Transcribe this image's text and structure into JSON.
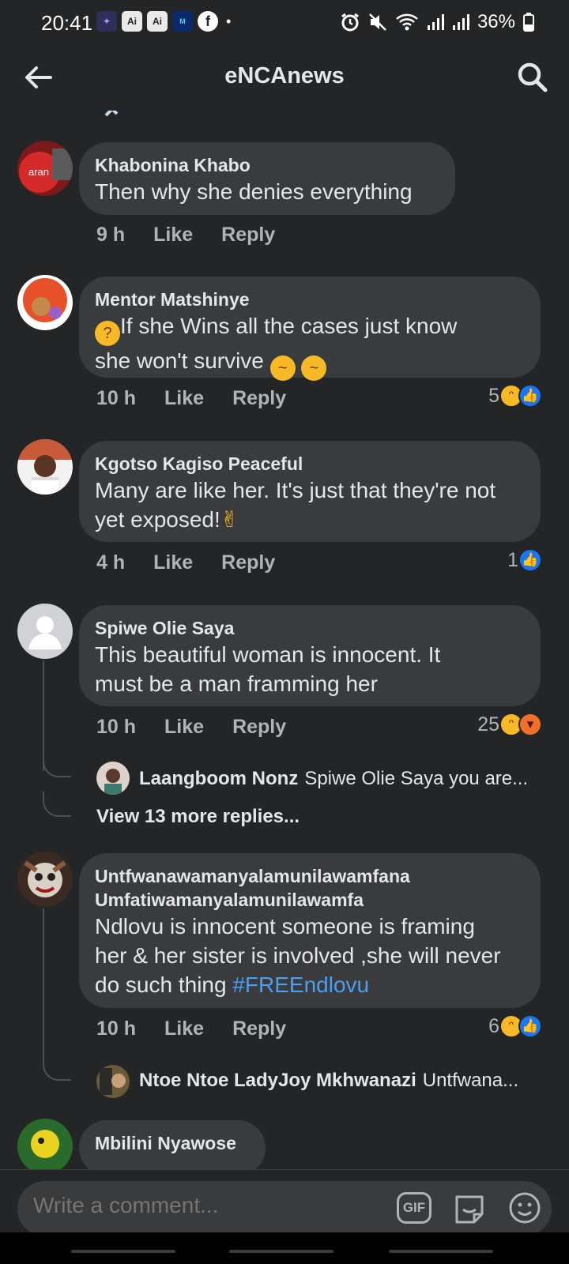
{
  "status_bar": {
    "time": "20:41",
    "app_icons": [
      "Ai",
      "Ai",
      "NEWMOVIES"
    ],
    "battery": "36%"
  },
  "header": {
    "title": "eNCAnews"
  },
  "comments": [
    {
      "author": "Khabonina Khabo",
      "text": "Then why she denies everything",
      "time": "9 h",
      "like_label": "Like",
      "reply_label": "Reply"
    },
    {
      "author": "Mentor Matshinye",
      "text_line1": "If she Wins all the cases just know",
      "text_line2": "she won't survive",
      "time": "10 h",
      "like_label": "Like",
      "reply_label": "Reply",
      "reaction_count": "5",
      "reactions": [
        "haha",
        "like"
      ]
    },
    {
      "author": "Kgotso Kagiso Peaceful",
      "text_line1": "Many are like her. It's just that they're not",
      "text_line2": "yet exposed!",
      "time": "4 h",
      "like_label": "Like",
      "reply_label": "Reply",
      "reaction_count": "1",
      "reactions": [
        "like"
      ]
    },
    {
      "author": "Spiwe Olie Saya",
      "text_line1": "This beautiful woman is innocent. It",
      "text_line2": "must be a man framming her",
      "time": "10 h",
      "like_label": "Like",
      "reply_label": "Reply",
      "reaction_count": "25",
      "reactions": [
        "haha",
        "angry"
      ],
      "reply_preview": {
        "author": "Laangboom Nonz",
        "text": "Spiwe Olie Saya you are..."
      },
      "view_more": "View 13 more replies..."
    },
    {
      "author_line1": "Untfwanawamanyalamunilawamfana",
      "author_line2": "Umfatiwamanyalamunilawamfa",
      "text_line1": "Ndlovu is innocent someone is framing",
      "text_line2": "her & her sister is involved ,she will never",
      "text_line3": "do such thing",
      "hashtag": "#FREEndlovu",
      "time": "10 h",
      "like_label": "Like",
      "reply_label": "Reply",
      "reaction_count": "6",
      "reactions": [
        "haha",
        "like"
      ],
      "reply_preview": {
        "author": "Ntoe Ntoe LadyJoy Mkhwanazi",
        "text": "Untfwana..."
      }
    },
    {
      "author": "Mbilini Nyawose"
    }
  ],
  "composer": {
    "placeholder": "Write a comment...",
    "gif_label": "GIF"
  },
  "colors": {
    "background": "#242526",
    "bubble": "#3a3b3c",
    "text": "#e4e6eb",
    "muted": "#b0b3b8",
    "link": "#4b9ef0",
    "like_blue": "#1877f2"
  }
}
